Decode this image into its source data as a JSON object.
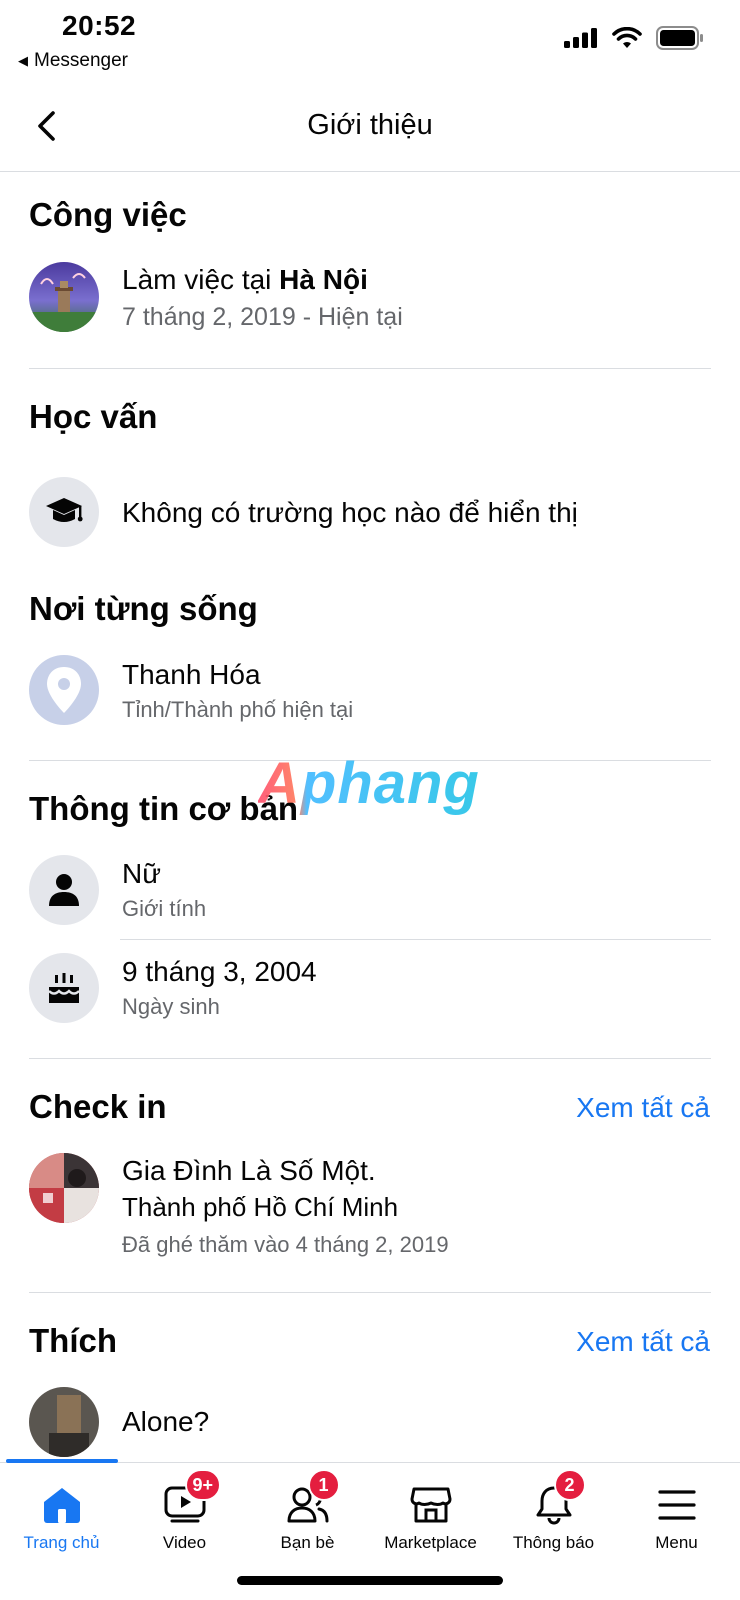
{
  "status_bar": {
    "time": "20:52",
    "back_app": "Messenger",
    "icons": [
      "signal-icon",
      "wifi-icon",
      "battery-icon"
    ]
  },
  "header": {
    "title": "Giới thiệu",
    "back_icon": "chevron-left-icon"
  },
  "work": {
    "title": "Công việc",
    "prefix": "Làm việc tại ",
    "place": "Hà Nội",
    "dates": "7 tháng 2, 2019 - Hiện tại"
  },
  "education": {
    "title": "Học vấn",
    "text": "Không có trường học nào để hiển thị",
    "icon": "graduation-cap-icon"
  },
  "lived": {
    "title": "Nơi từng sống",
    "city": "Thanh Hóa",
    "caption": "Tỉnh/Thành phố hiện tại",
    "icon": "map-pin-icon"
  },
  "watermark": "Aphang",
  "basic_info": {
    "title": "Thông tin cơ bản",
    "gender": {
      "value": "Nữ",
      "label": "Giới tính",
      "icon": "person-icon"
    },
    "birthday": {
      "value": "9 tháng 3, 2004",
      "label": "Ngày sinh",
      "icon": "cake-icon"
    }
  },
  "checkin": {
    "title": "Check in",
    "see_all": "Xem tất cả",
    "place": "Gia Đình Là Số Một.",
    "city": "Thành phố Hồ Chí Minh",
    "visited": "Đã ghé thăm vào 4 tháng 2, 2019"
  },
  "likes": {
    "title": "Thích",
    "see_all": "Xem tất cả",
    "first_item": "Alone?"
  },
  "tabbar": {
    "active_color": "#1877f2",
    "tabs": [
      {
        "label": "Trang chủ",
        "icon": "home-icon",
        "badge": ""
      },
      {
        "label": "Video",
        "icon": "video-icon",
        "badge": "9+"
      },
      {
        "label": "Bạn bè",
        "icon": "friends-icon",
        "badge": "1"
      },
      {
        "label": "Marketplace",
        "icon": "marketplace-icon",
        "badge": ""
      },
      {
        "label": "Thông báo",
        "icon": "bell-icon",
        "badge": "2"
      },
      {
        "label": "Menu",
        "icon": "menu-icon",
        "badge": ""
      }
    ]
  }
}
